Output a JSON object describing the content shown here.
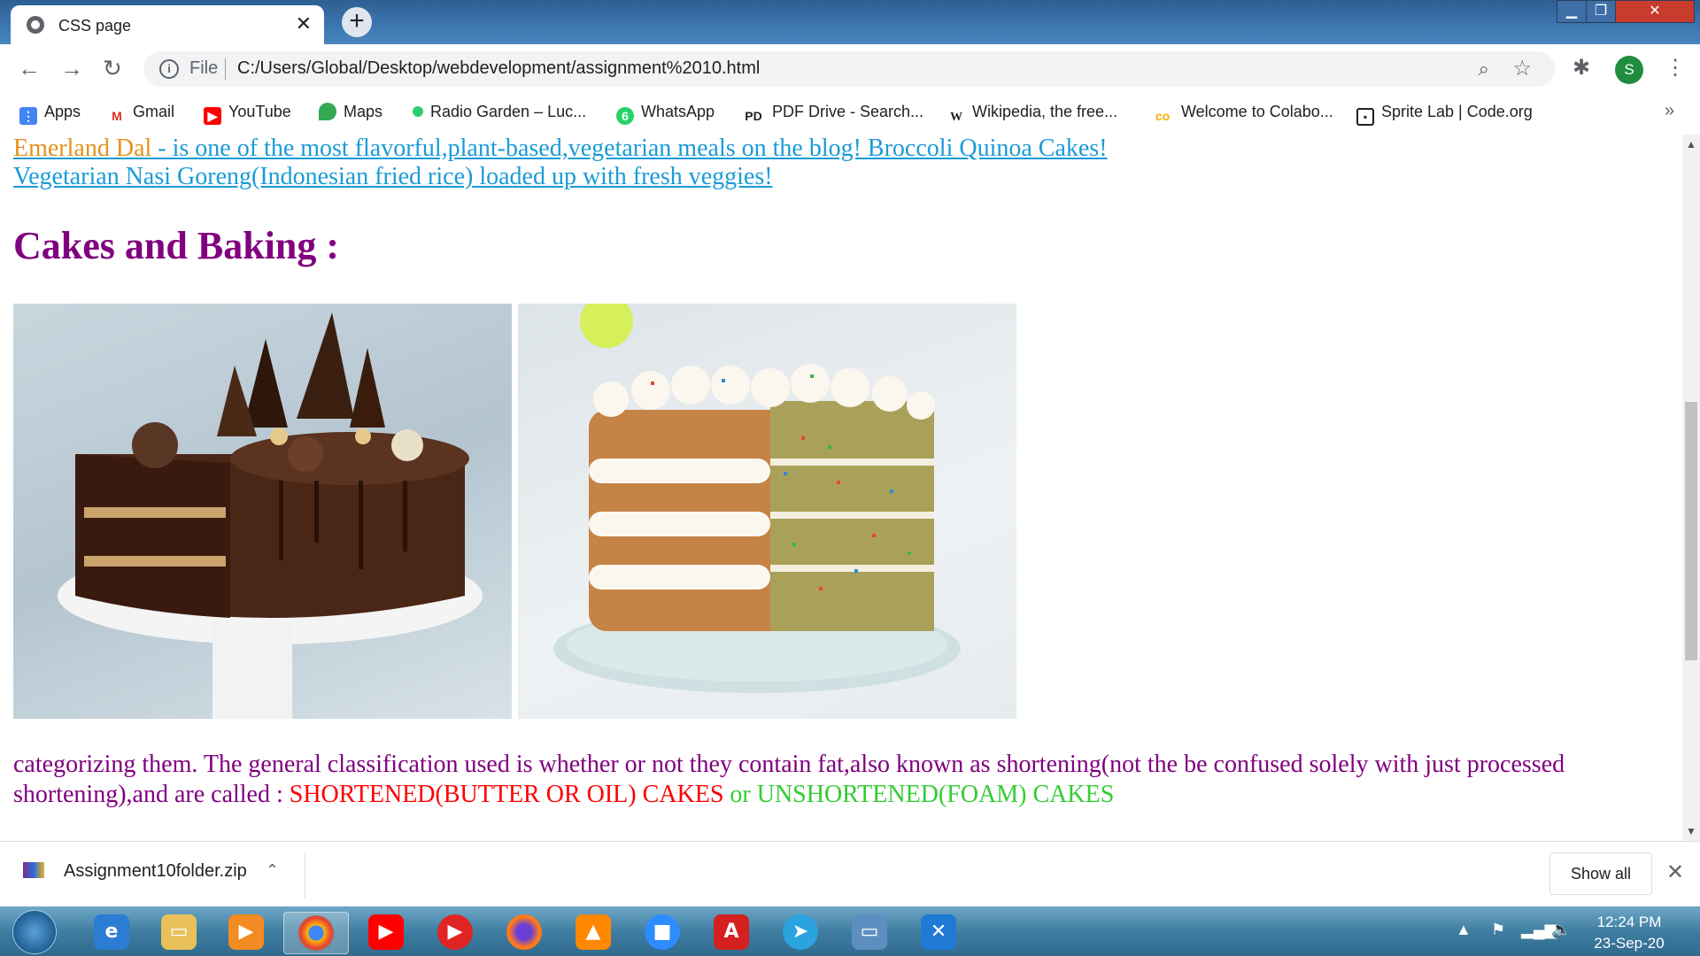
{
  "browser": {
    "tab_title": "CSS page",
    "url_scheme": "File",
    "url": "C:/Users/Global/Desktop/webdevelopment/assignment%2010.html",
    "profile_initial": "S"
  },
  "bookmarks": [
    {
      "label": "Apps",
      "icon": "apps-grid-icon",
      "color": "#4285f4"
    },
    {
      "label": "Gmail",
      "icon": "gmail-icon",
      "color": "#d93025"
    },
    {
      "label": "YouTube",
      "icon": "youtube-icon",
      "color": "#ff0000"
    },
    {
      "label": "Maps",
      "icon": "maps-icon",
      "color": "#34a853"
    },
    {
      "label": "Radio Garden – Luc...",
      "icon": "radio-garden-icon",
      "color": "#2ecc71"
    },
    {
      "label": "WhatsApp",
      "icon": "whatsapp-icon",
      "color": "#25d366"
    },
    {
      "label": "PDF Drive - Search...",
      "icon": "pdf-drive-icon",
      "color": "#202124"
    },
    {
      "label": "Wikipedia, the free...",
      "icon": "wikipedia-icon",
      "color": "#202124"
    },
    {
      "label": "Welcome to Colabo...",
      "icon": "colab-icon",
      "color": "#f9ab00"
    },
    {
      "label": "Sprite Lab | Code.org",
      "icon": "code-org-icon",
      "color": "#202124"
    }
  ],
  "page": {
    "link1_orange": "Emerland Dal",
    "link1_rest": " - is one of the most flavorful,plant-based,vegetarian meals on the blog! Broccoli Quinoa Cakes!",
    "link2": "Vegetarian Nasi Goreng(Indonesian fried rice) loaded up with fresh veggies!",
    "heading": "Cakes and Baking :",
    "para_text": "categorizing them. The general classification used is whether or not they contain fat,also known as shortening(not the be confused solely with just processed shortening),and are called : ",
    "para_red": "SHORTENED(BUTTER OR OIL) CAKES",
    "para_green": " or UNSHORTENED(FOAM) CAKES"
  },
  "downloads": {
    "file_name": "Assignment10folder.zip",
    "show_all": "Show all"
  },
  "taskbar": {
    "time": "12:24 PM",
    "date": "23-Sep-20"
  },
  "colors": {
    "heading": "#800080",
    "link": "#1a9bd7",
    "link_orange": "#e5911b",
    "red": "#ff0000",
    "green": "#32cd32"
  }
}
